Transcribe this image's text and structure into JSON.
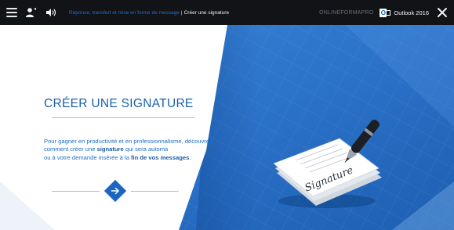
{
  "topbar": {
    "breadcrumb_section": "Réponse, transfert et mise en forme de message",
    "breadcrumb_separator": "|",
    "breadcrumb_current": "Créer une signature",
    "brand": "ONLINEFORMAPRO",
    "outlook_logo_letter": "O",
    "product": "Outlook 2016"
  },
  "slide": {
    "title": "Créer une signature",
    "desc_part1": "Pour gagner en productivité et en professionnalisme, découvrez comment créer une ",
    "desc_strong1": "signature",
    "desc_part2": " qui sera automa",
    "desc_part3": "ou à votre demande insérée à la ",
    "desc_strong2": "fin de vos messages",
    "desc_part4": ".",
    "signature_text": "Signature"
  },
  "icons": {
    "menu": "hamburger-icon",
    "user": "user-icon",
    "sound": "sound-icon",
    "close": "close-icon",
    "next": "arrow-right-icon",
    "outlook": "outlook-logo-icon"
  },
  "colors": {
    "topbar_bg": "#111316",
    "accent_blue": "#1d66c0",
    "title_blue": "#1c5fa8",
    "panel_blue": "#2b72c9",
    "breadcrumb_link": "#1f74c9"
  }
}
